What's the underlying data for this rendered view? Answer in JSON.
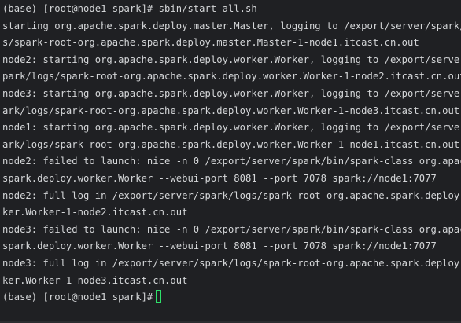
{
  "terminal": {
    "first_prompt": "(base) [root@node1 spark]# ",
    "first_command": "sbin/start-all.sh",
    "output_lines": [
      "starting org.apache.spark.deploy.master.Master, logging to /export/server/spark/log",
      "s/spark-root-org.apache.spark.deploy.master.Master-1-node1.itcast.cn.out",
      "node2: starting org.apache.spark.deploy.worker.Worker, logging to /export/server/s",
      "park/logs/spark-root-org.apache.spark.deploy.worker.Worker-1-node2.itcast.cn.out",
      "node3: starting org.apache.spark.deploy.worker.Worker, logging to /export/server/sp",
      "ark/logs/spark-root-org.apache.spark.deploy.worker.Worker-1-node3.itcast.cn.out",
      "node1: starting org.apache.spark.deploy.worker.Worker, logging to /export/server/sp",
      "ark/logs/spark-root-org.apache.spark.deploy.worker.Worker-1-node1.itcast.cn.out",
      "node2: failed to launch: nice -n 0 /export/server/spark/bin/spark-class org.apache.",
      "spark.deploy.worker.Worker --webui-port 8081 --port 7078 spark://node1:7077",
      "node2: full log in /export/server/spark/logs/spark-root-org.apache.spark.deploy.wor",
      "ker.Worker-1-node2.itcast.cn.out",
      "node3: failed to launch: nice -n 0 /export/server/spark/bin/spark-class org.apache.",
      "spark.deploy.worker.Worker --webui-port 8081 --port 7078 spark://node1:7077",
      "node3: full log in /export/server/spark/logs/spark-root-org.apache.spark.deploy.wor",
      "ker.Worker-1-node3.itcast.cn.out"
    ],
    "final_prompt": "(base) [root@node1 spark]#",
    "colors": {
      "background": "#1f2023",
      "text": "#d4d6d8",
      "cursor": "#2ee06a"
    }
  }
}
